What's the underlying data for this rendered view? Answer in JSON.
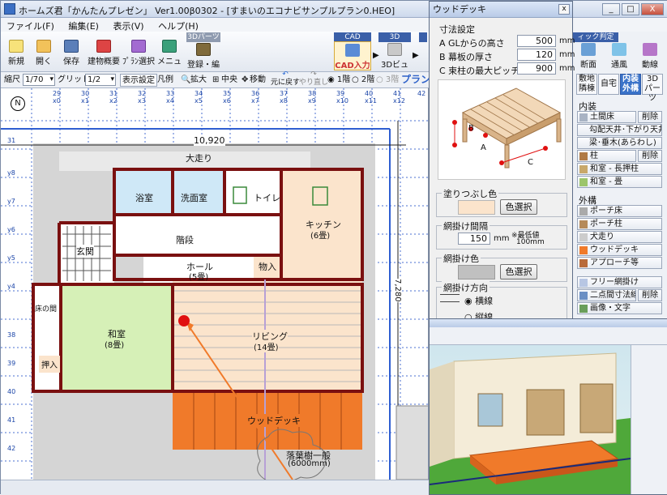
{
  "window": {
    "title": "ホームズ君「かんたんプレゼン」 Ver1.00β0302 - [すまいのエコナビサンプルプラン0.HEO]",
    "controls": [
      "_",
      "□",
      "X"
    ]
  },
  "menu": [
    "ファイル(F)",
    "編集(E)",
    "表示(V)",
    "ヘルプ(H)"
  ],
  "toolbar": {
    "buttons": [
      "新規",
      "開く",
      "保存",
      "建物概要",
      "ﾌﾟﾗﾝ選択",
      "メニュー",
      "登録・編集"
    ],
    "tab_3dparts": "3Dパーツ",
    "cad_tab": "CAD",
    "cad_label": "CAD入力",
    "d3_tab": "3D",
    "d3_label": "3Dビュー",
    "right_tab": "ィック判定",
    "right_buttons": [
      "断面",
      "通風",
      "動線"
    ]
  },
  "toolbar2": {
    "scale_label": "縮尺",
    "scale_value": "1/70",
    "grid_label": "グリッド幅",
    "grid_value": "1/2",
    "display_settings": "表示設定",
    "legend": "凡例",
    "zoom": "拡大",
    "center": "中央",
    "move": "移動",
    "undo": "元に戻す",
    "redo": "やり直し",
    "floor1": "1階",
    "floor2": "2階",
    "floor3": "3階",
    "plan_tab": "プラン"
  },
  "ruler": {
    "top": [
      "29",
      "30",
      "31",
      "32",
      "33",
      "34",
      "35",
      "36",
      "37",
      "38",
      "39",
      "40",
      "41",
      "42",
      "43"
    ],
    "top_sub": [
      "x0",
      "x1",
      "x2",
      "x3",
      "x4",
      "x5",
      "x6",
      "x7",
      "x8",
      "x9",
      "x10",
      "x11",
      "x12"
    ],
    "left": [
      "31",
      "y8",
      "y7",
      "y6",
      "y5",
      "y4",
      "38",
      "39",
      "40",
      "41",
      "42"
    ]
  },
  "plan": {
    "width_dim": "10,920",
    "height_dim": "7,280",
    "rooms": {
      "okuri": "大走り",
      "bath": "浴室",
      "senmen": "洗面室",
      "toilet": "トイレ",
      "kitchen": "キッチン",
      "kitchen_size": "(6畳)",
      "stairs": "階段",
      "genkan": "玄関",
      "hall": "ホール",
      "hall_size": "(5畳)",
      "storage": "物入",
      "washitsu": "和室",
      "washitsu_size": "(8畳)",
      "living": "リビング",
      "living_size": "(14畳)",
      "tokonoma": "床の間",
      "oshiire": "押入",
      "deck": "ウッドデッキ",
      "tree": "落葉樹一般",
      "tree_size": "(6000mm)"
    }
  },
  "dialog": {
    "title": "ウッドデッキ",
    "close": "x",
    "dims_title": "寸法設定",
    "rows": [
      {
        "label": "A  GLからの高さ",
        "value": "500",
        "unit": "mm"
      },
      {
        "label": "B  幕板の厚さ",
        "value": "120",
        "unit": "mm"
      },
      {
        "label": "C  束柱の最大ピッチ",
        "value": "900",
        "unit": "mm"
      }
    ],
    "fill_color_title": "塗りつぶし色",
    "color_btn": "色選択",
    "hatch_spacing_title": "網掛け間隔",
    "hatch_spacing_value": "150",
    "hatch_spacing_unit": "mm",
    "hatch_min_note": "※最低値",
    "hatch_min_value": "100mm",
    "hatch_color_title": "網掛け色",
    "hatch_color_btn": "色選択",
    "hatch_dir_title": "網掛け方向",
    "dir_horizontal": "横線",
    "dir_vertical": "縦線",
    "diagram_labels": [
      "A",
      "B",
      "C"
    ]
  },
  "right_panel": {
    "tabs": [
      "敷地隣棟",
      "自宅",
      "内装外構",
      "3Dパーツ"
    ],
    "section_naisou": "内装",
    "naisou_items": [
      "土間床",
      "勾配天井･下がり天井",
      "梁･垂木(あらわし)",
      "柱",
      "和室 - 長押柱",
      "和室 - 畳"
    ],
    "delete": "削除",
    "section_gaiko": "外構",
    "gaiko_items": [
      "ポーチ床",
      "ポーチ柱",
      "犬走り",
      "ウッドデッキ",
      "アプローチ等"
    ],
    "free_hatch": "フリー網掛け",
    "dim_line": "二点間寸法線",
    "image_text": "画像・文字"
  },
  "colors": {
    "deck": "#f07a2a",
    "washitsu": "#d6f0b7",
    "kitchen": "#fbe4cc",
    "bath": "#cfe8f7",
    "wall": "#7a1010",
    "grid": "#4a6fd1",
    "marker": "#e01010",
    "arrow": "#f07a2a"
  }
}
